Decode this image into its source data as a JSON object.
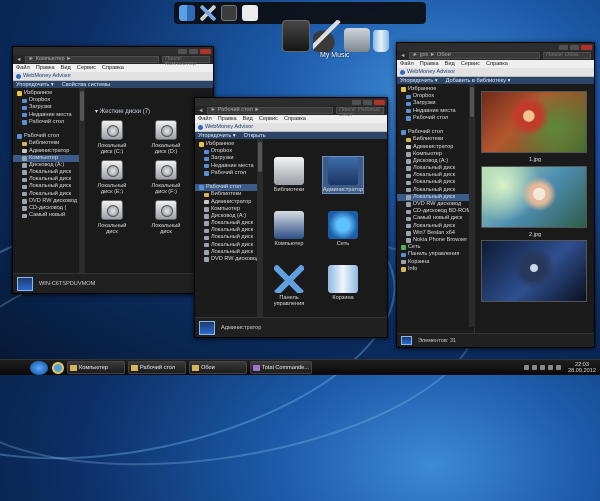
{
  "dock": {
    "icons": [
      "finder-icon",
      "tools-icon",
      "notes-icon",
      "document-icon"
    ]
  },
  "desktop": {
    "big_icons": [
      "folder-icon",
      "guitar-icon",
      "computer-icon",
      "trash-icon"
    ],
    "hover_label": "My Music"
  },
  "w1": {
    "title_path": "► Компьютер ►",
    "search": "Поиск: Компьютер",
    "menu": [
      "Файл",
      "Правка",
      "Вид",
      "Сервис",
      "Справка"
    ],
    "webmoney": "WebMoney Advisor",
    "cmd": [
      "Упорядочить ▾",
      "Свойства системы"
    ],
    "nav": [
      {
        "label": "Избранное",
        "icon": "star",
        "indent": false
      },
      {
        "label": "Dropbox",
        "icon": "blue",
        "indent": true
      },
      {
        "label": "Загрузки",
        "icon": "blue",
        "indent": true
      },
      {
        "label": "Недавние места",
        "icon": "blue",
        "indent": true
      },
      {
        "label": "Рабочий стол",
        "icon": "blue",
        "indent": true
      },
      {
        "label": "",
        "icon": "",
        "indent": false
      },
      {
        "label": "Рабочий стол",
        "icon": "blue",
        "indent": false
      },
      {
        "label": "Библиотеки",
        "icon": "fld",
        "indent": true
      },
      {
        "label": "Администратор",
        "icon": "usr",
        "indent": true
      },
      {
        "label": "Компьютер",
        "icon": "disk",
        "indent": true,
        "selected": true
      },
      {
        "label": "Дисковод (A:)",
        "icon": "disk",
        "indent": true
      },
      {
        "label": "Локальный диск",
        "icon": "disk",
        "indent": true
      },
      {
        "label": "Локальный диск",
        "icon": "disk",
        "indent": true
      },
      {
        "label": "Локальный диск",
        "icon": "disk",
        "indent": true
      },
      {
        "label": "Локальный диск",
        "icon": "disk",
        "indent": true
      },
      {
        "label": "DVD RW дисковод",
        "icon": "disk",
        "indent": true
      },
      {
        "label": "CD-дисковод (",
        "icon": "disk",
        "indent": true
      },
      {
        "label": "Самый новый",
        "icon": "disk",
        "indent": true
      }
    ],
    "group": "▾ Жесткие диски (7)",
    "drives": [
      "Локальный диск (C:)",
      "Локальный диск (D:)",
      "Локальный диск (E:)",
      "Локальный диск (F:)",
      "Локальный диск",
      "Локальный диск"
    ],
    "status": "WIN-C6TSPDUVMOM"
  },
  "w2": {
    "title_path": "► Рабочий стол ►",
    "search": "Поиск: Рабочий стол",
    "menu": [
      "Файл",
      "Правка",
      "Вид",
      "Сервис",
      "Справка"
    ],
    "webmoney": "WebMoney Advisor",
    "cmd": [
      "Упорядочить ▾",
      "Открыть"
    ],
    "nav": [
      {
        "label": "Избранное",
        "icon": "star",
        "indent": false
      },
      {
        "label": "Dropbox",
        "icon": "blue",
        "indent": true
      },
      {
        "label": "Загрузки",
        "icon": "blue",
        "indent": true
      },
      {
        "label": "Недавние места",
        "icon": "blue",
        "indent": true
      },
      {
        "label": "Рабочий стол",
        "icon": "blue",
        "indent": true
      },
      {
        "label": "",
        "icon": "",
        "indent": false
      },
      {
        "label": "Рабочий стол",
        "icon": "blue",
        "indent": false,
        "selected": true
      },
      {
        "label": "Библиотеки",
        "icon": "fld",
        "indent": true
      },
      {
        "label": "Администратор",
        "icon": "usr",
        "indent": true
      },
      {
        "label": "Компьютер",
        "icon": "disk",
        "indent": true
      },
      {
        "label": "Дисковод (A:)",
        "icon": "disk",
        "indent": true
      },
      {
        "label": "Локальный диск",
        "icon": "disk",
        "indent": true
      },
      {
        "label": "Локальный диск",
        "icon": "disk",
        "indent": true
      },
      {
        "label": "Локальный диск",
        "icon": "disk",
        "indent": true
      },
      {
        "label": "Локальный диск",
        "icon": "disk",
        "indent": true
      },
      {
        "label": "Локальный диск",
        "icon": "disk",
        "indent": true
      },
      {
        "label": "DVD RW дисковод",
        "icon": "disk",
        "indent": true
      }
    ],
    "items": [
      "Библиотеки",
      "Администратор",
      "Компьютер",
      "Сеть",
      "Панель управления",
      "Корзина"
    ],
    "status": "Администратор"
  },
  "w3": {
    "title_path": "► gxs ► Обои",
    "search": "Поиск: Обои",
    "menu": [
      "Файл",
      "Правка",
      "Вид",
      "Сервис",
      "Справка"
    ],
    "webmoney": "WebMoney Advisor",
    "cmd": [
      "Упорядочить ▾",
      "Добавить в библиотеку ▾"
    ],
    "nav": [
      {
        "label": "Избранное",
        "icon": "star",
        "indent": false
      },
      {
        "label": "Dropbox",
        "icon": "blue",
        "indent": true
      },
      {
        "label": "Загрузки",
        "icon": "blue",
        "indent": true
      },
      {
        "label": "Недавние места",
        "icon": "blue",
        "indent": true
      },
      {
        "label": "Рабочий стол",
        "icon": "blue",
        "indent": true
      },
      {
        "label": "",
        "icon": "",
        "indent": false
      },
      {
        "label": "Рабочий стол",
        "icon": "blue",
        "indent": false
      },
      {
        "label": "Библиотеки",
        "icon": "fld",
        "indent": true
      },
      {
        "label": "Администратор",
        "icon": "usr",
        "indent": true
      },
      {
        "label": "Компьютер",
        "icon": "disk",
        "indent": true
      },
      {
        "label": "Дисковод (A:)",
        "icon": "disk",
        "indent": true
      },
      {
        "label": "Локальный диск",
        "icon": "disk",
        "indent": true
      },
      {
        "label": "Локальный диск",
        "icon": "disk",
        "indent": true
      },
      {
        "label": "Локальный диск",
        "icon": "disk",
        "indent": true
      },
      {
        "label": "Локальный диск",
        "icon": "disk",
        "indent": true
      },
      {
        "label": "Локальный диск",
        "icon": "disk",
        "indent": true,
        "selected": true
      },
      {
        "label": "DVD RW дисковод",
        "icon": "disk",
        "indent": true
      },
      {
        "label": "CD-дисковод BD-ROM",
        "icon": "disk",
        "indent": true
      },
      {
        "label": "Самый новый диск",
        "icon": "disk",
        "indent": true
      },
      {
        "label": "Локальный диск",
        "icon": "disk",
        "indent": true
      },
      {
        "label": "Win7 Beslan x64",
        "icon": "disk",
        "indent": true
      },
      {
        "label": "Nokia Phone Browser",
        "icon": "disk",
        "indent": true
      },
      {
        "label": "Сеть",
        "icon": "grn",
        "indent": false
      },
      {
        "label": "Панель управления",
        "icon": "blue",
        "indent": false
      },
      {
        "label": "Корзина",
        "icon": "disk",
        "indent": false
      },
      {
        "label": "Info",
        "icon": "fld",
        "indent": false
      }
    ],
    "photos": [
      "1.jpg",
      "2.jpg",
      ""
    ],
    "status": "Элементов: 31"
  },
  "taskbar": {
    "buttons": [
      "Компьютер",
      "Рабочий стол",
      "Обои",
      "Total Commande..."
    ],
    "time": "22:03",
    "date": "28.09.2012"
  }
}
